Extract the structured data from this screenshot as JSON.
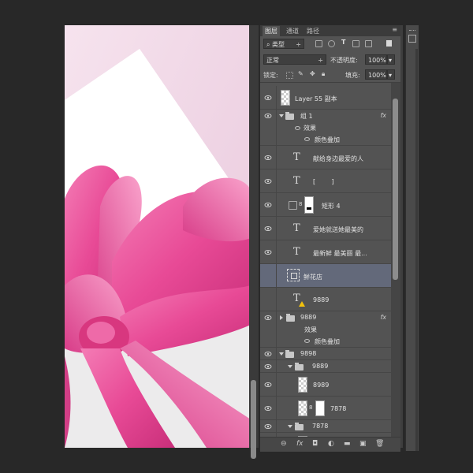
{
  "panel": {
    "tabs": [
      "图层",
      "通道",
      "路径"
    ],
    "filter_label": "类型",
    "blend_mode": "正常",
    "opacity_label": "不透明度:",
    "opacity_value": "100%",
    "lock_label": "锁定:",
    "fill_label": "填充:",
    "fill_value": "100%",
    "menu_icon": "panel-menu-icon"
  },
  "layers": [
    {
      "name": "Layer 55 副本",
      "kind": "pixel"
    },
    {
      "name": "组 1",
      "kind": "group",
      "fx": "fx"
    },
    {
      "name": "效果",
      "kind": "effect-header"
    },
    {
      "name": "颜色叠加",
      "kind": "effect"
    },
    {
      "name": "献给身边最爱的人",
      "kind": "text"
    },
    {
      "name": "[        ]",
      "kind": "text"
    },
    {
      "name": "矩形 4",
      "kind": "shape"
    },
    {
      "name": "爱她就送她最美的",
      "kind": "text"
    },
    {
      "name": "最新鲜  最美丽  最...",
      "kind": "text"
    },
    {
      "name": "鲜花店",
      "kind": "smart",
      "selected": true
    },
    {
      "name": "9889",
      "kind": "text-warning"
    },
    {
      "name": "9889",
      "kind": "group-collapsed",
      "fx": "fx"
    },
    {
      "name": "效果",
      "kind": "effect-header"
    },
    {
      "name": "颜色叠加",
      "kind": "effect"
    },
    {
      "name": "9898",
      "kind": "group"
    },
    {
      "name": "9889",
      "kind": "group"
    },
    {
      "name": "8989",
      "kind": "pixel"
    },
    {
      "name": "7878",
      "kind": "masked"
    },
    {
      "name": "7878",
      "kind": "group"
    }
  ],
  "bottom_bar": [
    "link-icon",
    "fx",
    "mask-icon",
    "adjustment-icon",
    "folder-icon",
    "new-layer-icon",
    "trash-icon"
  ],
  "colors": {
    "panel": "#535353",
    "selected": "#63697a",
    "ribbon": "#e8559a"
  }
}
